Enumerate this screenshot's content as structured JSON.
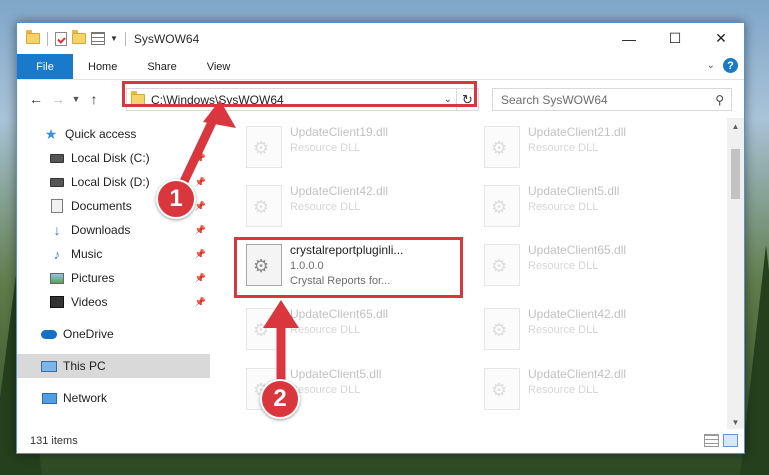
{
  "window": {
    "title": "SysWOW64",
    "controls": {
      "minimize": "—",
      "maximize": "☐",
      "close": "✕"
    }
  },
  "ribbon": {
    "tabs": [
      {
        "label": "File",
        "active": true
      },
      {
        "label": "Home"
      },
      {
        "label": "Share"
      },
      {
        "label": "View"
      }
    ],
    "expand_icon": "chevron-down-icon",
    "help": "?"
  },
  "address_bar": {
    "path": "C:\\Windows\\SysWOW64",
    "refresh_icon": "↻"
  },
  "search": {
    "placeholder": "Search SysWOW64"
  },
  "sidebar": {
    "items": [
      {
        "label": "Quick access",
        "icon": "star-icon"
      },
      {
        "label": "Local Disk (C:)",
        "icon": "drive-icon",
        "pinned": true
      },
      {
        "label": "Local Disk (D:)",
        "icon": "drive-icon",
        "pinned": true
      },
      {
        "label": "Documents",
        "icon": "documents-icon",
        "pinned": true
      },
      {
        "label": "Downloads",
        "icon": "downloads-icon",
        "pinned": true
      },
      {
        "label": "Music",
        "icon": "music-icon",
        "pinned": true
      },
      {
        "label": "Pictures",
        "icon": "pictures-icon",
        "pinned": true
      },
      {
        "label": "Videos",
        "icon": "videos-icon",
        "pinned": true
      },
      {
        "label": "OneDrive",
        "icon": "onedrive-icon"
      },
      {
        "label": "This PC",
        "icon": "pc-icon",
        "selected": true
      },
      {
        "label": "Network",
        "icon": "network-icon"
      }
    ]
  },
  "files": [
    {
      "name": "UpdateClient19.dll",
      "sub": "Resource DLL",
      "faded": true
    },
    {
      "name": "UpdateClient21.dll",
      "sub": "Resource DLL",
      "faded": true
    },
    {
      "name": "UpdateClient42.dll",
      "sub": "Resource DLL",
      "faded": true
    },
    {
      "name": "UpdateClient5.dll",
      "sub": "Resource DLL",
      "faded": true
    },
    {
      "name": "crystalreportpluginli...",
      "sub": "1.0.0.0",
      "sub2": "Crystal Reports for...",
      "faded": false
    },
    {
      "name": "UpdateClient65.dll",
      "sub": "Resource DLL",
      "faded": true
    },
    {
      "name": "UpdateClient65.dll",
      "sub": "Resource DLL",
      "faded": true
    },
    {
      "name": "UpdateClient42.dll",
      "sub": "Resource DLL",
      "faded": true
    },
    {
      "name": "UpdateClient5.dll",
      "sub": "Resource DLL",
      "faded": true
    },
    {
      "name": "UpdateClient42.dll",
      "sub": "Resource DLL",
      "faded": true
    }
  ],
  "status": {
    "item_count": "131 items"
  },
  "callouts": [
    "1",
    "2"
  ],
  "colors": {
    "accent": "#1979ca",
    "annotation": "#d9363e"
  }
}
